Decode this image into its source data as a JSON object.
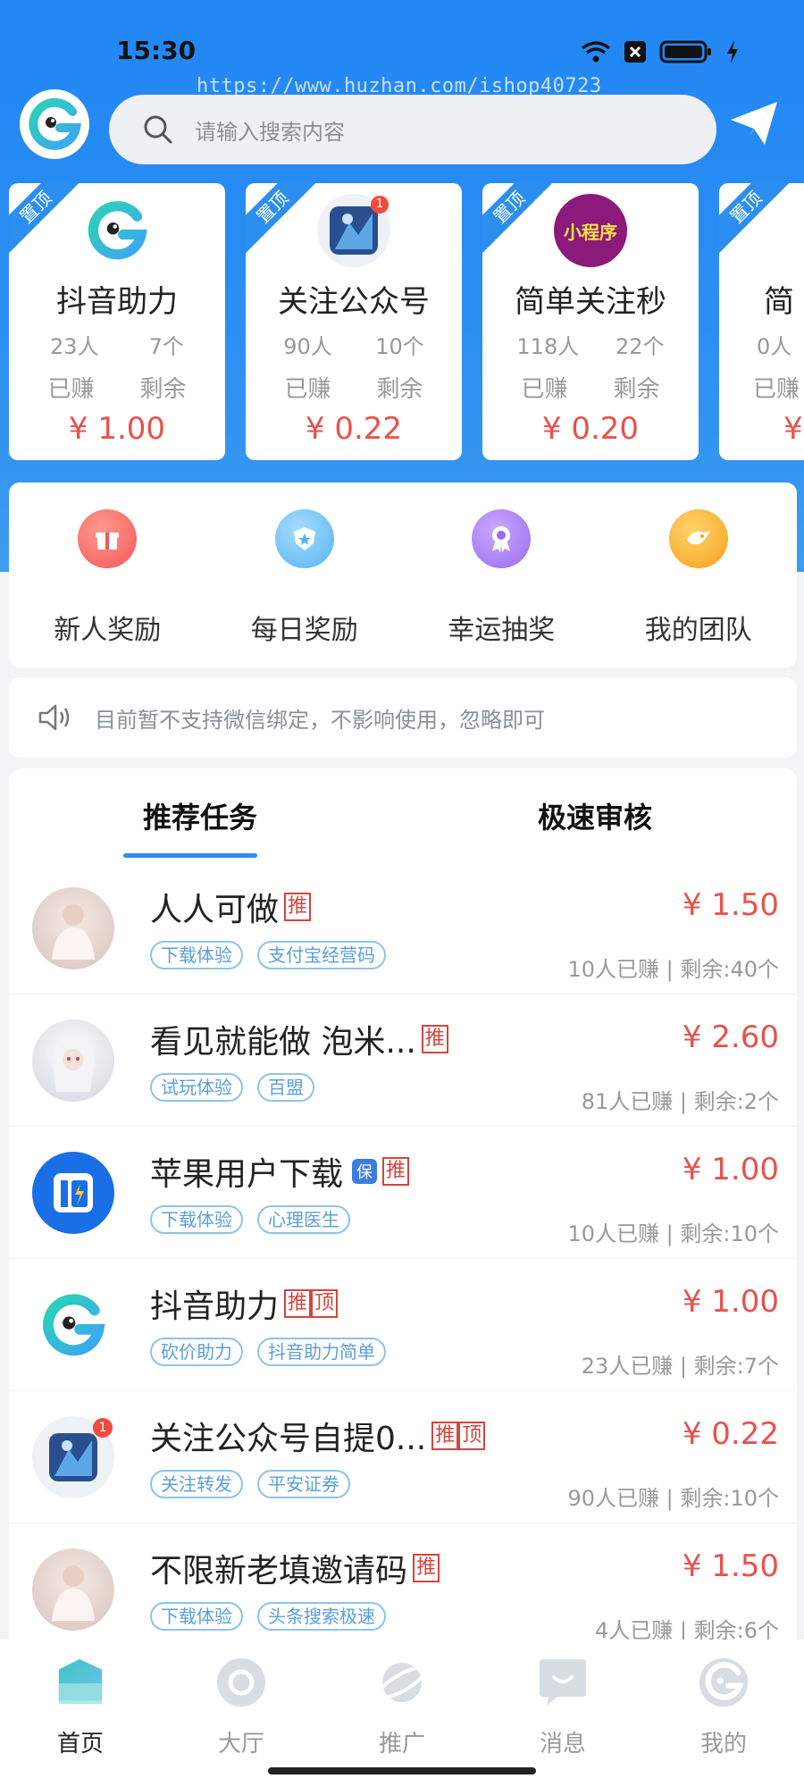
{
  "status_bar": {
    "time": "15:30",
    "icons": [
      "wifi-icon",
      "sim-off-icon",
      "battery-icon",
      "charging-icon"
    ]
  },
  "watermark": "https://www.huzhan.com/ishop40723",
  "header": {
    "search_placeholder": "请输入搜索内容",
    "search_icon": "search-icon",
    "send_icon": "paper-plane-icon"
  },
  "top_cards": [
    {
      "badge": "置顶",
      "icon": "app-logo-g-icon",
      "title": "抖音助力",
      "earned_count": "23人",
      "remaining_count": "7个",
      "earned_label": "已赚",
      "remaining_label": "剩余",
      "price": "¥ 1.00"
    },
    {
      "badge": "置顶",
      "icon": "game-avatar-icon",
      "notification": "1",
      "title": "关注公众号",
      "earned_count": "90人",
      "remaining_count": "10个",
      "earned_label": "已赚",
      "remaining_label": "剩余",
      "price": "¥ 0.22"
    },
    {
      "badge": "置顶",
      "icon": "mini-program-icon",
      "icon_text": "小程序",
      "title": "简单关注秒",
      "earned_count": "118人",
      "remaining_count": "22个",
      "earned_label": "已赚",
      "remaining_label": "剩余",
      "price": "¥ 0.20"
    },
    {
      "badge": "置顶",
      "icon": "partial-icon",
      "title": "简",
      "earned_count": "0人",
      "remaining_count": "",
      "earned_label": "已赚",
      "remaining_label": "",
      "price": "¥"
    }
  ],
  "menu": [
    {
      "label": "新人奖励",
      "icon": "gift-icon",
      "color": "#f2575a"
    },
    {
      "label": "每日奖励",
      "icon": "shield-star-icon",
      "color": "#56b3f2"
    },
    {
      "label": "幸运抽奖",
      "icon": "award-ribbon-icon",
      "color": "#9b6bf0"
    },
    {
      "label": "我的团队",
      "icon": "team-icon",
      "color": "#f7a21d"
    }
  ],
  "notice": {
    "icon": "speaker-icon",
    "text": "目前暂不支持微信绑定，不影响使用，忽略即可"
  },
  "tasks": {
    "tabs": [
      "推荐任务",
      "极速审核"
    ],
    "items": [
      {
        "title": "人人可做",
        "tags": [
          "推"
        ],
        "chips": [
          "下载体验",
          "支付宝经营码"
        ],
        "price": "¥ 1.50",
        "stats": "10人已赚 | 剩余:40个",
        "avatar": "girl-photo-avatar"
      },
      {
        "title": "看见就能做 泡米...",
        "tags": [
          "推"
        ],
        "chips": [
          "试玩体验",
          "百盟"
        ],
        "price": "¥ 2.60",
        "stats": "81人已赚 | 剩余:2个",
        "avatar": "anime-girl-avatar"
      },
      {
        "title": "苹果用户下载",
        "tags": [
          "推"
        ],
        "verified": "保",
        "chips": [
          "下载体验",
          "心理医生"
        ],
        "price": "¥ 1.00",
        "stats": "10人已赚 | 剩余:10个",
        "avatar": "lightning-app-avatar"
      },
      {
        "title": "抖音助力",
        "tags": [
          "推",
          "顶"
        ],
        "chips": [
          "砍价助力",
          "抖音助力简单"
        ],
        "price": "¥ 1.00",
        "stats": "23人已赚 | 剩余:7个",
        "avatar": "app-logo-g-avatar"
      },
      {
        "title": "关注公众号自提0...",
        "tags": [
          "推",
          "顶"
        ],
        "chips": [
          "关注转发",
          "平安证券"
        ],
        "price": "¥ 0.22",
        "stats": "90人已赚 | 剩余:10个",
        "avatar": "game-avatar",
        "notification": "1"
      },
      {
        "title": "不限新老填邀请码",
        "tags": [
          "推"
        ],
        "chips": [
          "下载体验",
          "头条搜索极速"
        ],
        "price": "¥ 1.50",
        "stats": "4人已赚 | 剩余:6个",
        "avatar": "girl-photo-avatar"
      }
    ]
  },
  "bottom_nav": [
    {
      "label": "首页",
      "icon": "home-icon",
      "active": true
    },
    {
      "label": "大厅",
      "icon": "hall-icon",
      "active": false
    },
    {
      "label": "推广",
      "icon": "planet-icon",
      "active": false
    },
    {
      "label": "消息",
      "icon": "message-icon",
      "active": false
    },
    {
      "label": "我的",
      "icon": "profile-icon",
      "active": false
    }
  ],
  "colors": {
    "brand_blue": "#2287f4",
    "price_red": "#e8524c",
    "chip_blue": "#5b9fd8"
  }
}
